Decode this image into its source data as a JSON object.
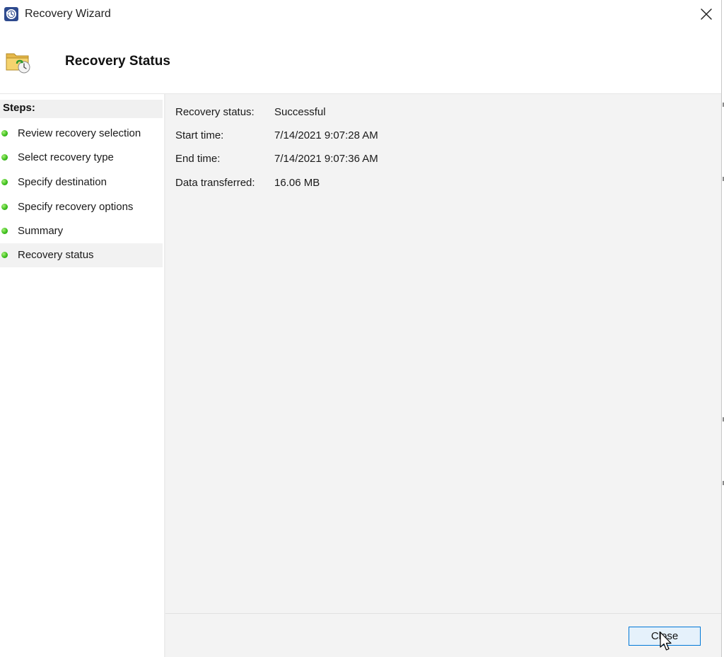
{
  "window": {
    "title": "Recovery Wizard",
    "app_icon": "clock-backup-icon",
    "close_icon": "close-icon"
  },
  "header": {
    "title": "Recovery Status",
    "icon": "folder-recovery-icon"
  },
  "steps": {
    "heading": "Steps:",
    "status_color": "#3fc11f",
    "items": [
      {
        "label": "Review recovery selection",
        "active": false
      },
      {
        "label": "Select recovery type",
        "active": false
      },
      {
        "label": "Specify destination",
        "active": false
      },
      {
        "label": "Specify recovery options",
        "active": false
      },
      {
        "label": "Summary",
        "active": false
      },
      {
        "label": "Recovery status",
        "active": true
      }
    ]
  },
  "details": [
    {
      "label": "Recovery status:",
      "value": "Successful"
    },
    {
      "label": "Start time:",
      "value": "7/14/2021 9:07:28 AM"
    },
    {
      "label": "End time:",
      "value": "7/14/2021 9:07:36 AM"
    },
    {
      "label": "Data transferred:",
      "value": "16.06 MB"
    }
  ],
  "footer": {
    "close_label": "Close",
    "accent": "#0078d7"
  }
}
